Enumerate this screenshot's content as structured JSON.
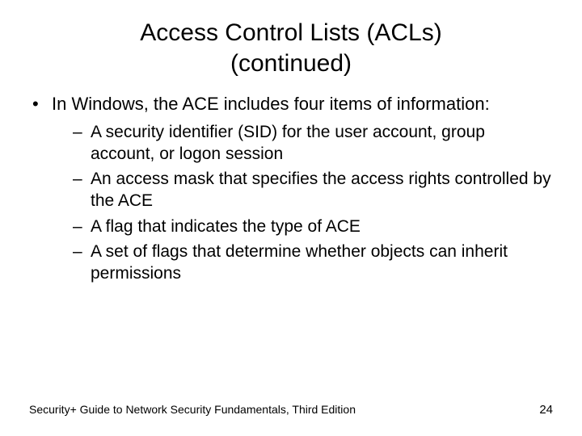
{
  "title_line1": "Access Control Lists (ACLs)",
  "title_line2": "(continued)",
  "bullet_intro": "In Windows, the ACE includes four items of information:",
  "sub_items": [
    "A security identifier (SID) for the user account, group account, or logon session",
    "An access mask that specifies the access rights controlled by the ACE",
    "A flag that indicates the type of ACE",
    "A set of flags that determine whether objects can inherit permissions"
  ],
  "footer_text": "Security+ Guide to Network Security Fundamentals, Third Edition",
  "page_number": "24"
}
